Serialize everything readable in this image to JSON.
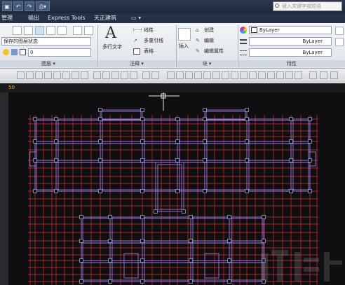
{
  "quick_access": [
    "保存",
    "撤销",
    "重做",
    "打印"
  ],
  "search": {
    "placeholder": "键入关键字或短语"
  },
  "tabs": [
    "管理",
    "输出",
    "Express Tools",
    "天正建筑"
  ],
  "ribbon": {
    "layer_state": "保存的图层状态",
    "layer_current": "0",
    "annotation": {
      "mtext": "多行文字",
      "linear": "线性",
      "multileader": "多重引线",
      "table": "表格"
    },
    "block": {
      "insert": "插入",
      "create": "创建",
      "edit": "编辑",
      "edit_attributes": "编辑属性"
    },
    "properties": {
      "color": "ByLayer",
      "linetype": "ByLayer",
      "lineweight": "ByLayer"
    },
    "groups": {
      "layers": "图层 ▾",
      "annotation": "注释 ▾",
      "block": "块 ▾",
      "properties": "特性"
    }
  },
  "file_tab": {
    "label": "50"
  },
  "colors": {
    "background": "#0f0f12",
    "red_grid": "#d8302c",
    "purple_wall": "#a478e0",
    "column": "#8fa6c8"
  }
}
